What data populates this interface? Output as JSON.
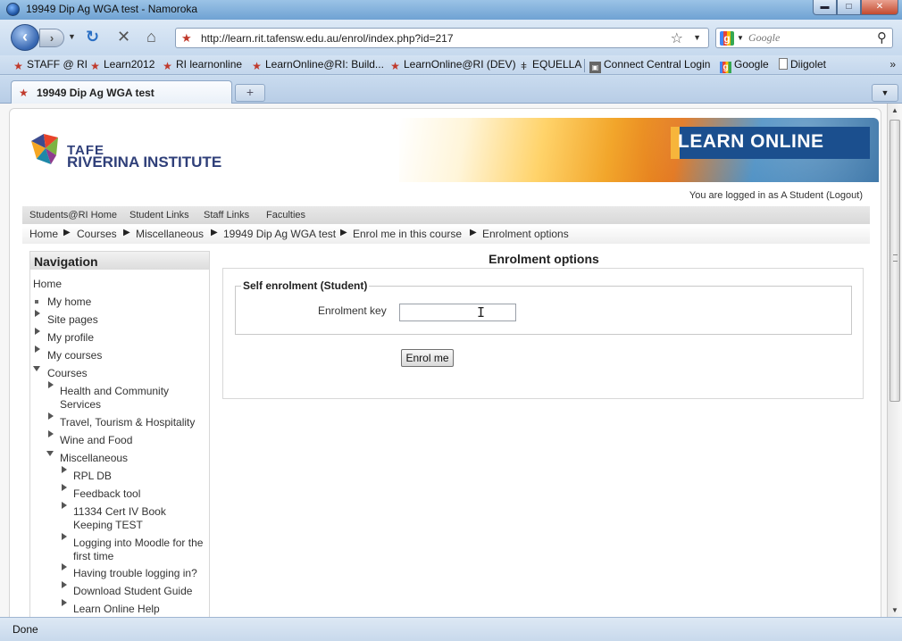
{
  "window": {
    "title": "19949 Dip Ag WGA test - Namoroka"
  },
  "toolbar": {
    "url": "http://learn.rit.tafensw.edu.au/enrol/index.php?id=217",
    "search_placeholder": "Google"
  },
  "bookmarks": [
    {
      "label": "STAFF @ RI"
    },
    {
      "label": "Learn2012"
    },
    {
      "label": "RI learnonline"
    },
    {
      "label": "LearnOnline@RI: Build..."
    },
    {
      "label": "LearnOnline@RI (DEV)"
    },
    {
      "label": "EQUELLA"
    },
    {
      "label": "Connect Central Login"
    },
    {
      "label": "Google"
    },
    {
      "label": "Diigolet"
    }
  ],
  "tab": {
    "label": "19949 Dip Ag WGA test"
  },
  "header": {
    "logo_line1": "TAFE",
    "logo_line2": "RIVERINA INSTITUTE",
    "banner": "LEARN ONLINE",
    "logged_in_text": "You are logged in as A Student (Logout)"
  },
  "menu": [
    "Students@RI Home",
    "Student Links",
    "Staff Links",
    "Faculties"
  ],
  "breadcrumb": [
    "Home",
    "Courses",
    "Miscellaneous",
    "19949 Dip Ag WGA test",
    "Enrol me in this course",
    "Enrolment options"
  ],
  "navigation": {
    "title": "Navigation",
    "home": "Home",
    "my_home": "My home",
    "site_pages": "Site pages",
    "my_profile": "My profile",
    "my_courses": "My courses",
    "courses": "Courses",
    "course_categories": [
      "Health and Community Services",
      "Travel, Tourism & Hospitality",
      "Wine and Food",
      "Miscellaneous"
    ],
    "misc_items": [
      "RPL DB",
      "Feedback tool",
      "11334 Cert IV Book Keeping TEST",
      "Logging into Moodle for the first time",
      "Having trouble logging in?",
      "Download Student Guide",
      "Learn Online Help"
    ]
  },
  "main": {
    "title": "Enrolment options",
    "legend": "Self enrolment (Student)",
    "key_label": "Enrolment key",
    "key_value": "",
    "button": "Enrol me"
  },
  "status": {
    "text": "Done"
  },
  "colors": {
    "brand": "#2f3f79",
    "banner_blue": "#1b4f8e",
    "accent": "#f7b53b"
  }
}
